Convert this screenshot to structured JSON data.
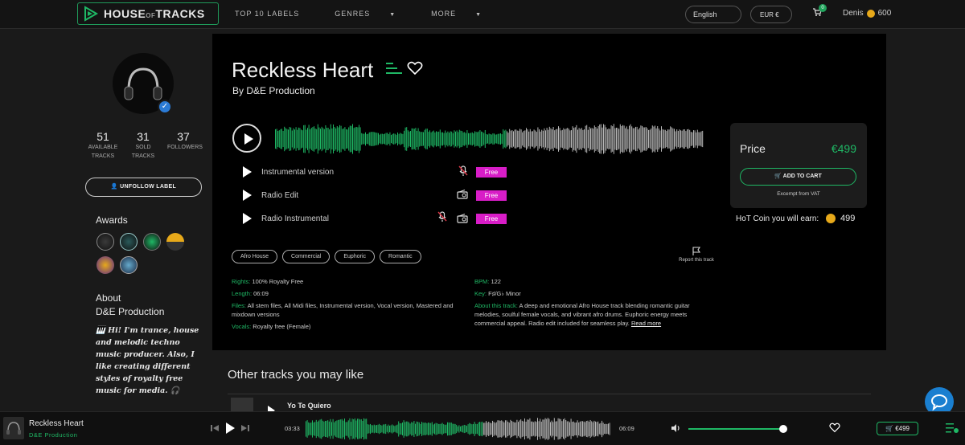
{
  "header": {
    "logo_text": "HOUSE",
    "logo_small": "OF",
    "logo_text2": "TRACKS",
    "nav": [
      {
        "label": "TOP 10 LABELS",
        "caret": false
      },
      {
        "label": "GENRES",
        "caret": true
      },
      {
        "label": "MORE",
        "caret": true
      }
    ],
    "language": "English",
    "currency": "EUR €",
    "cart_count": "0",
    "user_name": "Denis",
    "user_coins": "600"
  },
  "sidebar": {
    "stats": [
      {
        "value": "51",
        "label1": "AVAILABLE",
        "label2": "TRACKS"
      },
      {
        "value": "31",
        "label1": "SOLD",
        "label2": "TRACKS"
      },
      {
        "value": "37",
        "label1": "FOLLOWERS",
        "label2": ""
      }
    ],
    "unfollow_label": "UNFOLLOW LABEL",
    "awards_title": "Awards",
    "about_title_1": "About",
    "about_title_2": "D&E Production",
    "about_text": "🎹 Hi! I'm trance, house and melodic techno music producer. Also, I like creating different styles of royalty free music for media. 🎧"
  },
  "track": {
    "title": "Reckless Heart",
    "by": "By D&E Production",
    "versions": [
      {
        "name": "Instrumental version",
        "price": "Free",
        "icons": [
          "mic-off-icon"
        ]
      },
      {
        "name": "Radio Edit",
        "price": "Free",
        "icons": [
          "radio-icon"
        ]
      },
      {
        "name": "Radio Instrumental",
        "price": "Free",
        "icons": [
          "mic-off-icon",
          "radio-icon"
        ]
      }
    ],
    "tags": [
      "Afro House",
      "Commercial",
      "Euphoric",
      "Romantic"
    ],
    "report_label": "Report this track",
    "meta_left": [
      {
        "key": "Rights:",
        "value": "100% Royalty Free"
      },
      {
        "key": "Length:",
        "value": "06:09"
      },
      {
        "key": "Files:",
        "value": "All stem files, All Midi files, Instrumental version, Vocal version, Mastered and mixdown versions"
      },
      {
        "key": "Vocals:",
        "value": "Royalty free (Female)"
      }
    ],
    "meta_right": [
      {
        "key": "BPM:",
        "value": "122"
      },
      {
        "key": "Key:",
        "value": "F♯/G♭ Minor"
      },
      {
        "key": "About this track:",
        "value": "A deep and emotional Afro House track blending romantic guitar melodies, soulful female vocals, and vibrant afro drums. Euphoric energy meets commercial appeal. Radio edit included for seamless play.",
        "link": "Read more"
      }
    ],
    "progress": 0.54
  },
  "price_card": {
    "label": "Price",
    "value": "€499",
    "add_to_cart": "ADD TO CART",
    "vat_note": "Excempt from VAT",
    "hot_coin_label": "HoT Coin you will earn:",
    "hot_coin_value": "499"
  },
  "other": {
    "title": "Other tracks you may like",
    "first_track": "Yo Te Quiero"
  },
  "player": {
    "title": "Reckless Heart",
    "artist": "D&E Production",
    "elapsed": "03:33",
    "total": "06:09",
    "price": "€499",
    "progress": 0.58,
    "volume": 0.95
  },
  "colors": {
    "accent": "#1fb865",
    "free_tag": "#d81dc7",
    "coin": "#e7a91a",
    "help": "#1a7fd0"
  }
}
